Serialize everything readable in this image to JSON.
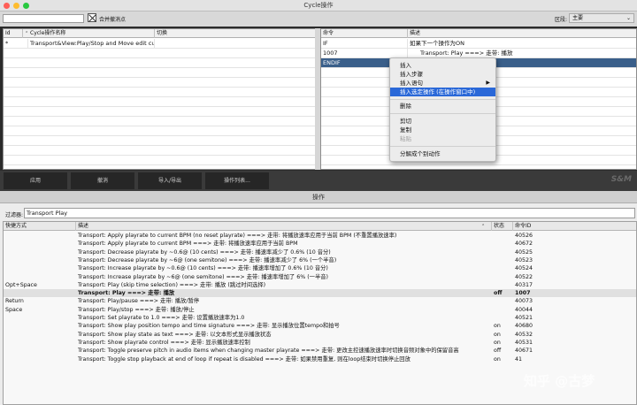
{
  "window_top": {
    "title": "Cycle操作",
    "filter_value": "",
    "checkbox_label": "合并撤消点",
    "section_label": "区段:",
    "section_value": "主要",
    "left_table": {
      "columns": [
        "Id",
        "Cycle操作名称",
        "切换"
      ],
      "rows": [
        {
          "id": "*",
          "name": "Transport&View:Play/Stop and Move edit curs",
          "toggle": ""
        }
      ]
    },
    "right_table": {
      "columns": [
        "命令",
        "描述"
      ],
      "rows": [
        {
          "cmd": "IF",
          "desc": "如果下一个操作为ON"
        },
        {
          "cmd": "1007",
          "desc": "Transport: Play ===> 走带: 播放"
        },
        {
          "cmd": "ENDIF",
          "desc": ""
        }
      ]
    },
    "buttons": [
      "应用",
      "撤消",
      "导入/导出",
      "操作列表..."
    ],
    "logo": "S&M"
  },
  "context_menu": {
    "items": [
      {
        "label": "插入",
        "state": "normal"
      },
      {
        "label": "插入步骤",
        "state": "normal"
      },
      {
        "label": "插入语句",
        "state": "submenu"
      },
      {
        "label": "插入选定操作 (在操作窗口中)",
        "state": "highlighted"
      },
      {
        "label": "删除",
        "state": "normal"
      },
      {
        "label": "剪切",
        "state": "normal"
      },
      {
        "label": "复制",
        "state": "normal"
      },
      {
        "label": "粘贴",
        "state": "disabled"
      },
      {
        "label": "分解成个别动作",
        "state": "normal"
      }
    ]
  },
  "window_actions": {
    "title": "操作",
    "filter_label": "过滤器:",
    "filter_value": "Transport Play",
    "columns": [
      "快捷方式",
      "描述",
      "状态",
      "命令ID"
    ],
    "rows": [
      {
        "shortcut": "",
        "desc": "Transport: Apply playrate to current BPM (no reset playrate) ===> 走带: 将播放速率应用于当前 BPM (不重置播放速率)",
        "state": "",
        "id": "40526"
      },
      {
        "shortcut": "",
        "desc": "Transport: Apply playrate to current BPM ===> 走带: 将播放速率应用于当前 BPM",
        "state": "",
        "id": "40672"
      },
      {
        "shortcut": "",
        "desc": "Transport: Decrease playrate by ~0.6@ (10 cents) ===> 走带: 播速率减少了 0.6% (10 音分)",
        "state": "",
        "id": "40525"
      },
      {
        "shortcut": "",
        "desc": "Transport: Decrease playrate by ~6@ (one semitone) ===> 走带: 播速率减少了 6% (一个半音)",
        "state": "",
        "id": "40523"
      },
      {
        "shortcut": "",
        "desc": "Transport: Increase playrate by ~0.6@ (10 cents) ===> 走带: 播速率增加了 0.6% (10 音分)",
        "state": "",
        "id": "40524"
      },
      {
        "shortcut": "",
        "desc": "Transport: Increase playrate by ~6@ (one semitone) ===> 走带: 播速率增加了 6% (一半音)",
        "state": "",
        "id": "40522"
      },
      {
        "shortcut": "Opt+Space",
        "desc": "Transport: Play (skip time selection) ===> 走带: 播放 (跳过时间选择)",
        "state": "",
        "id": "40317"
      },
      {
        "shortcut": "",
        "desc": "Transport: Play ===> 走带: 播放",
        "state": "off",
        "id": "1007"
      },
      {
        "shortcut": "Return",
        "desc": "Transport: Play/pause ===> 走带: 播放/暂停",
        "state": "",
        "id": "40073"
      },
      {
        "shortcut": "Space",
        "desc": "Transport: Play/stop ===> 走带: 播放/停止",
        "state": "",
        "id": "40044"
      },
      {
        "shortcut": "",
        "desc": "Transport: Set playrate to 1.0 ===> 走带: 设置播放速率为1.0",
        "state": "",
        "id": "40521"
      },
      {
        "shortcut": "",
        "desc": "Transport: Show play position tempo and time signature ===> 走带: 显示播放位置tempo和拍号",
        "state": "on",
        "id": "40680"
      },
      {
        "shortcut": "",
        "desc": "Transport: Show play state as text ===> 走带: 以文本形式显示播放状态",
        "state": "on",
        "id": "40532"
      },
      {
        "shortcut": "",
        "desc": "Transport: Show playrate control ===> 走带: 显示播放速率控制",
        "state": "on",
        "id": "40531"
      },
      {
        "shortcut": "",
        "desc": "Transport: Toggle preserve pitch in audio items when changing master playrate ===> 走带: 更改主控速播放速率时切换音频对象中的保留音高",
        "state": "off",
        "id": "40671"
      },
      {
        "shortcut": "",
        "desc": "Transport: Toggle stop playback at end of loop if repeat is disabled ===> 走带: 如果禁用重复, 则在loop结束时切换停止回放",
        "state": "on",
        "id": "41"
      }
    ]
  },
  "watermark": "知乎 @古梦"
}
